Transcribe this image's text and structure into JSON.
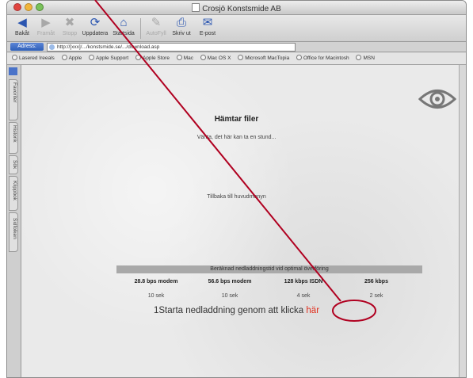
{
  "window": {
    "title": "Crosjö Konstsmide AB"
  },
  "toolbar": {
    "buttons": [
      {
        "label": "Bakåt",
        "icon": "back-arrow-icon",
        "enabled": true
      },
      {
        "label": "Framåt",
        "icon": "forward-arrow-icon",
        "enabled": false
      },
      {
        "label": "Stopp",
        "icon": "stop-icon",
        "enabled": false
      },
      {
        "label": "Uppdatera",
        "icon": "refresh-icon",
        "enabled": true
      },
      {
        "label": "Startsida",
        "icon": "home-icon",
        "enabled": true
      },
      {
        "label": "AutoFyll",
        "icon": "autofill-icon",
        "enabled": false
      },
      {
        "label": "Skriv ut",
        "icon": "print-icon",
        "enabled": true
      },
      {
        "label": "E-post",
        "icon": "mail-icon",
        "enabled": true
      }
    ]
  },
  "address": {
    "label": "Adress:",
    "url": "http://[xxx]/.../konstsmide.se/.../download.asp"
  },
  "favorites": [
    "Lasered Ireeals",
    "Apple",
    "Apple Support",
    "Apple Store",
    "Mac",
    "Mac OS X",
    "Microsoft MacTopia",
    "Office for Macintosh",
    "MSN"
  ],
  "side_tabs": [
    "Favoriter",
    "Historik",
    "Sök",
    "Klippbok",
    "Sidfolken"
  ],
  "page": {
    "title": "Hämtar filer",
    "wait_text": "Vänta, det här kan ta en stund...",
    "back_link": "Tillbaka till huvudmenyn",
    "download_header": "Beräknad nedladdningstid vid optimal överföring",
    "speeds": [
      {
        "label": "28.8 bps modem",
        "time": "10 sek"
      },
      {
        "label": "56.6 bps modem",
        "time": "10 sek"
      },
      {
        "label": "128 kbps ISDN",
        "time": "4 sek"
      },
      {
        "label": "256 kbps",
        "time": "2 sek"
      }
    ],
    "start_text": "1Starta nedladdning genom att klicka",
    "start_link": "här"
  },
  "colors": {
    "annotation": "#b00020",
    "link": "#e0301e"
  }
}
